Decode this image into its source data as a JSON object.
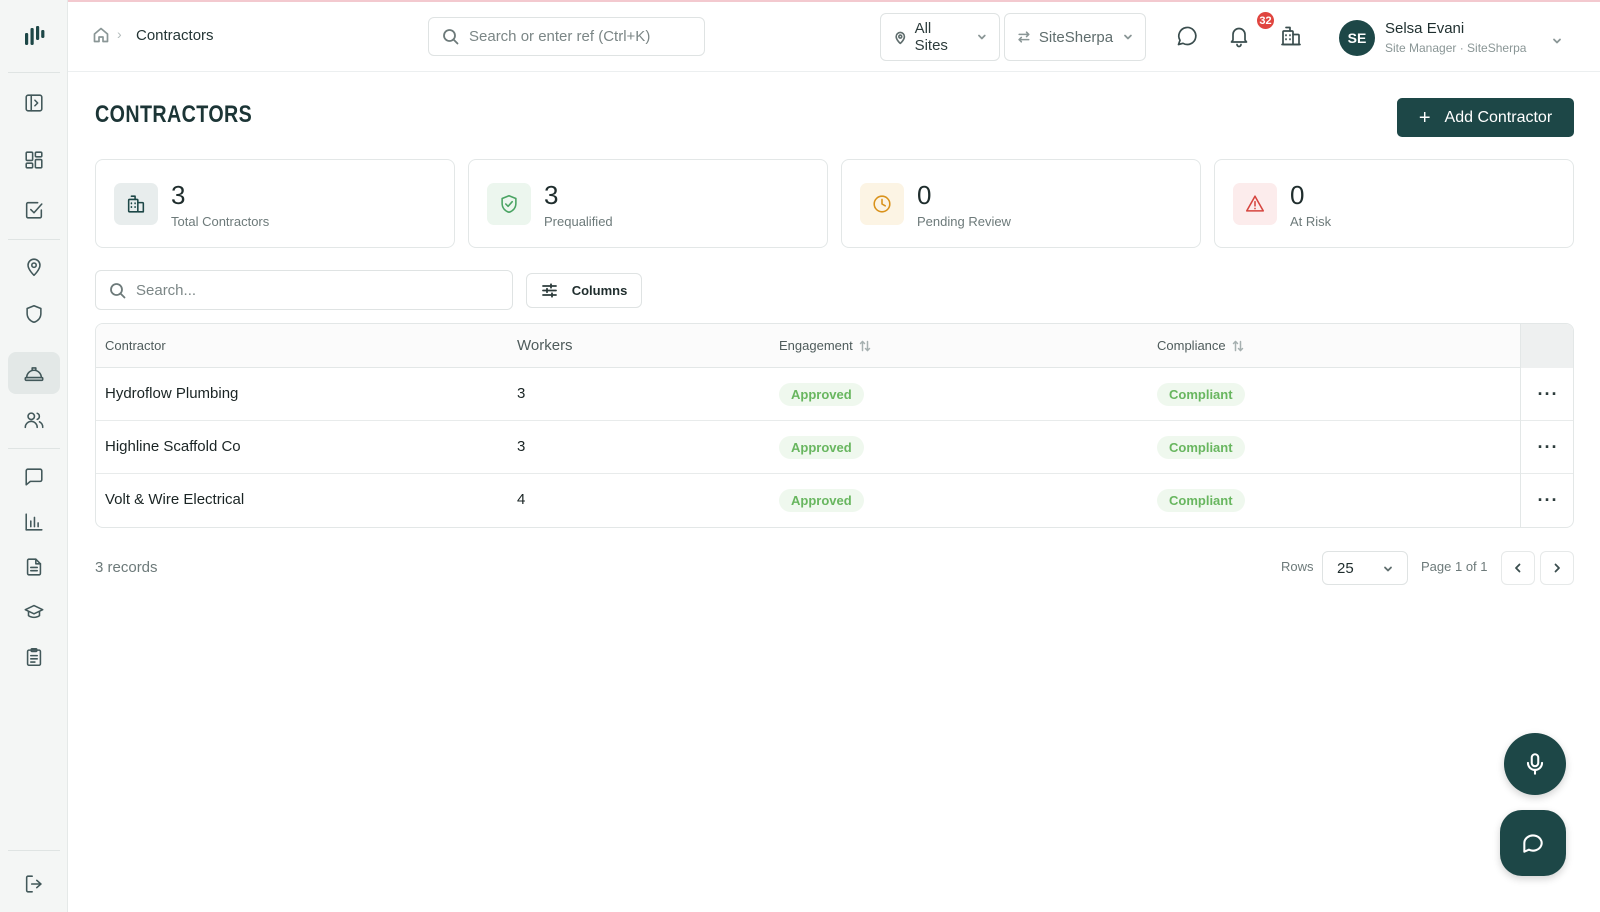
{
  "header": {
    "breadcrumb_current": "Contractors",
    "breadcrumb_sep": "›",
    "search_placeholder": "Search or enter ref (Ctrl+K)",
    "site_select": "All Sites",
    "org_select": "SiteSherpa",
    "notification_count": "32",
    "user": {
      "initials": "SE",
      "name": "Selsa Evani",
      "role": "Site Manager · SiteSherpa"
    }
  },
  "main": {
    "title": "CONTRACTORS",
    "add_button": "Add Contractor",
    "add_button_icon": "+"
  },
  "stats": [
    {
      "value": "3",
      "label": "Total Contractors",
      "icon": "building-icon",
      "color": "#1d4747"
    },
    {
      "value": "3",
      "label": "Prequalified",
      "icon": "shield-check-icon",
      "color": "#4aa463"
    },
    {
      "value": "0",
      "label": "Pending Review",
      "icon": "clock-icon",
      "color": "#d9921b"
    },
    {
      "value": "0",
      "label": "At Risk",
      "icon": "alert-triangle-icon",
      "color": "#d6453f"
    }
  ],
  "toolbar": {
    "search_placeholder": "Search...",
    "columns_label": "Columns"
  },
  "table": {
    "columns": [
      "Contractor",
      "Workers",
      "Engagement",
      "Compliance"
    ],
    "rows": [
      {
        "contractor": "Hydroflow Plumbing",
        "workers": "3",
        "engagement": "Approved",
        "compliance": "Compliant"
      },
      {
        "contractor": "Highline Scaffold Co",
        "workers": "3",
        "engagement": "Approved",
        "compliance": "Compliant"
      },
      {
        "contractor": "Volt & Wire Electrical",
        "workers": "4",
        "engagement": "Approved",
        "compliance": "Compliant"
      }
    ],
    "row_action": "···"
  },
  "footer": {
    "records": "3 records",
    "rows_label": "Rows",
    "rows_value": "25",
    "page_label": "Page 1 of 1"
  },
  "colors": {
    "brand": "#1d4747",
    "badge": "#e0453f",
    "success_text": "#68b65f",
    "success_bg": "#eff8ee"
  }
}
